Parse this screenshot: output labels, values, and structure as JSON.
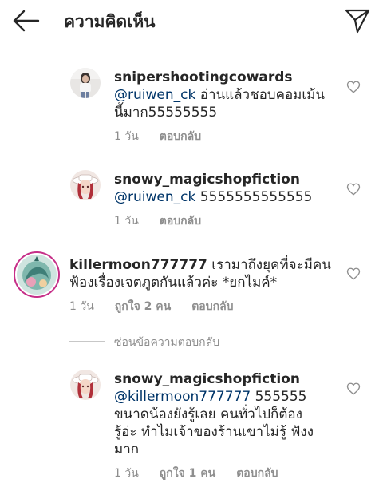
{
  "header": {
    "title": "ความคิดเห็น",
    "back_icon": "arrow-left-icon",
    "send_icon": "paper-plane-icon"
  },
  "comments": [
    {
      "username": "snipershootingcowards",
      "mention": "@ruiwen_ck",
      "text_line1": " อ่านแล้วชอบคอมเม้น",
      "text_line2": "นี้มาก55555555",
      "time": "1 วัน",
      "reply": "ตอบกลับ"
    },
    {
      "username": "snowy_magicshopfiction",
      "mention": "@ruiwen_ck",
      "text_line1": " 5555555555555",
      "time": "1 วัน",
      "reply": "ตอบกลับ"
    },
    {
      "username": "killermoon777777",
      "text_line1": " เรามาถึงยุคที่จะมีคน",
      "text_line2": "ฟ้องเรื่องเจตภูตกันแล้วค่ะ *ยกไมค์*",
      "time": "1 วัน",
      "likes": "ถูกใจ 2 คน",
      "reply": "ตอบกลับ"
    },
    {
      "username": "snowy_magicshopfiction",
      "mention": "@killermoon777777",
      "text_line1": " 555555",
      "text_line2": "ขนาดน้องยังรู้เลย คนทั่วไปก็ต้อง",
      "text_line3": "รู้อ่ะ ทำไมเจ้าของร้านเขาไม่รู้ ฟังง",
      "text_line4": "มาก",
      "time": "1 วัน",
      "likes": "ถูกใจ 1 คน",
      "reply": "ตอบกลับ"
    }
  ],
  "hide_replies": "ซ่อนข้อความตอบกลับ",
  "icons": {
    "like": "heart-outline-icon"
  },
  "colors": {
    "text": "#262626",
    "secondary": "#8e8e8e",
    "mention": "#003569",
    "story_ring": "#c62f88"
  }
}
